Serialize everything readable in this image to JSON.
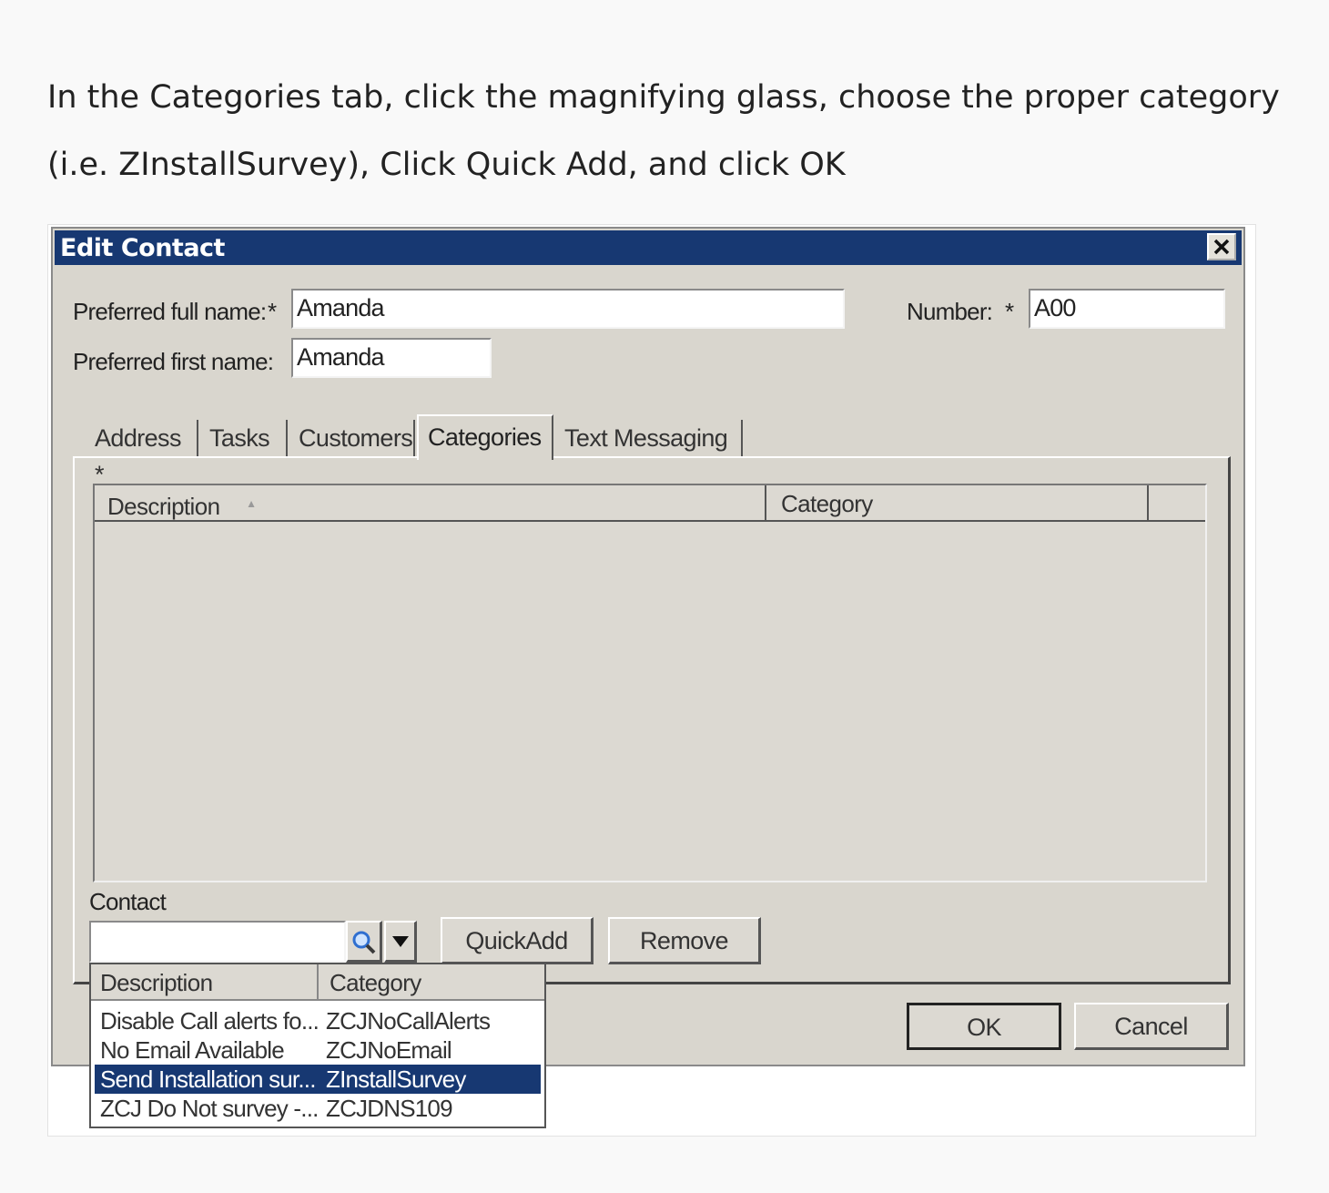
{
  "instruction": {
    "line1": "In the Categories tab, click the magnifying glass, choose the proper category",
    "line2": "(i.e. ZInstallSurvey), Click Quick Add, and click OK"
  },
  "dialog": {
    "title": "Edit Contact",
    "fields": {
      "preferred_full_name_label": "Preferred full name:",
      "preferred_full_name_value": "Amanda",
      "preferred_first_name_label": "Preferred first name:",
      "preferred_first_name_value": "Amanda",
      "number_label": "Number:",
      "number_value": "A00",
      "required_marker": "*"
    },
    "tabs": [
      {
        "label": "Address *"
      },
      {
        "label": "Tasks"
      },
      {
        "label": "Customers"
      },
      {
        "label": "Categories"
      },
      {
        "label": "Text Messaging"
      }
    ],
    "active_tab": "Categories",
    "grid": {
      "columns": [
        "Description",
        "Category"
      ],
      "sort_indicator": "▲"
    },
    "contact_label": "Contact",
    "buttons": {
      "quick_add": "QuickAdd",
      "remove": "Remove",
      "ok": "OK",
      "cancel": "Cancel"
    },
    "dropdown": {
      "columns": [
        "Description",
        "Category"
      ],
      "rows": [
        {
          "description": "Disable Call alerts fo...",
          "category": "ZCJNoCallAlerts"
        },
        {
          "description": "No Email Available",
          "category": "ZCJNoEmail"
        },
        {
          "description": "Send Installation sur...",
          "category": "ZInstallSurvey"
        },
        {
          "description": "ZCJ Do Not survey -...",
          "category": "ZCJDNS109"
        }
      ],
      "selected_index": 2
    }
  },
  "colors": {
    "titlebar": "#173872",
    "dialog_bg": "#d9d6ce",
    "selection": "#173872"
  },
  "icons": [
    "close-icon",
    "magnifying-glass-icon",
    "dropdown-arrow-icon"
  ]
}
